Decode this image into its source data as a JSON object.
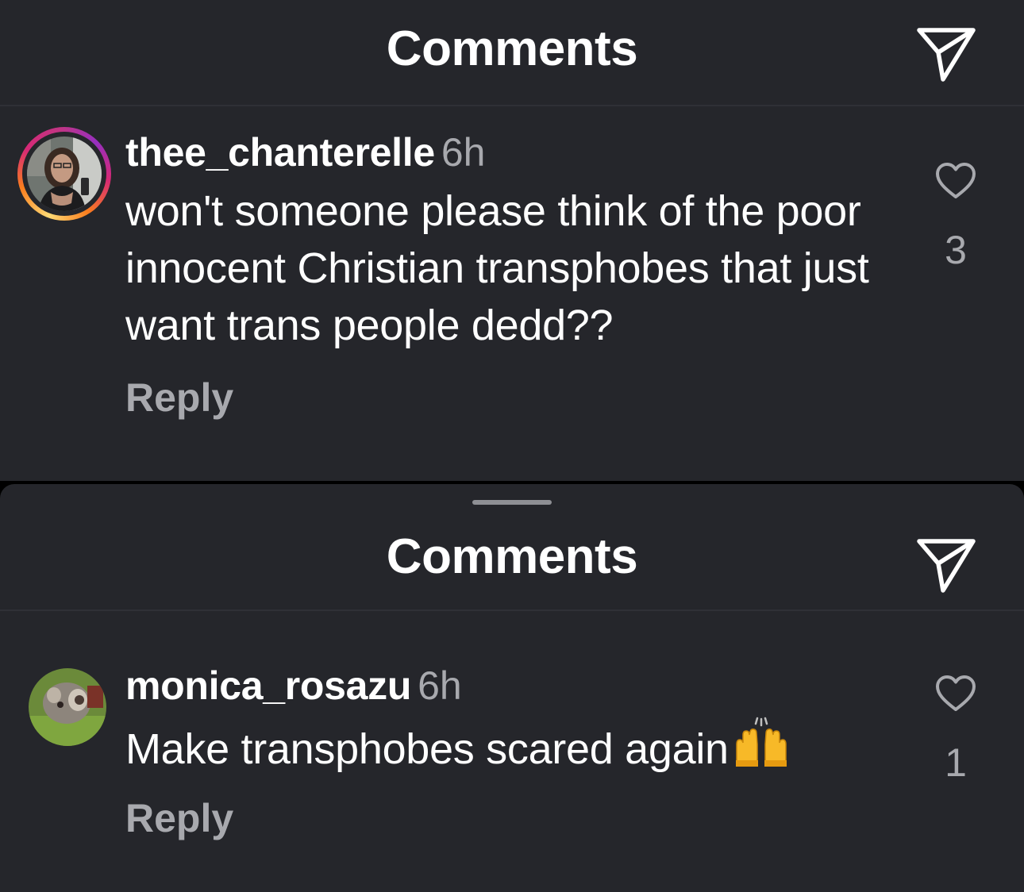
{
  "sheets": [
    {
      "title": "Comments",
      "comment": {
        "username": "thee_chanterelle",
        "timestamp": "6h",
        "text": "won't someone please think of the poor innocent Christian transphobes that just want trans people dedd??",
        "reply_label": "Reply",
        "like_count": "3",
        "avatar_has_story_ring": true
      }
    },
    {
      "title": "Comments",
      "comment": {
        "username": "monica_rosazu",
        "timestamp": "6h",
        "text": "Make transphobes scared again",
        "emoji": "raising-hands-emoji",
        "reply_label": "Reply",
        "like_count": "1",
        "avatar_has_story_ring": false
      }
    }
  ],
  "icons": {
    "send": "paper-plane-icon",
    "like": "heart-outline-icon"
  },
  "colors": {
    "background": "#25262b",
    "text_primary": "#ffffff",
    "text_secondary": "#a8a9ae",
    "divider": "#2f3036",
    "story_ring": [
      "#feda75",
      "#fa7e1e",
      "#d62976",
      "#962fbf"
    ]
  }
}
